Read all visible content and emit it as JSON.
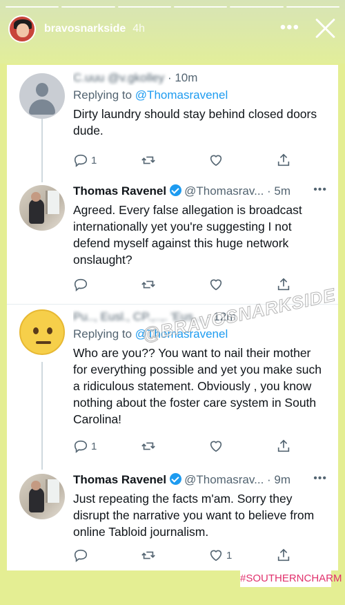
{
  "story": {
    "username": "bravosnarkside",
    "time": "4h",
    "more_icon": "more-horizontal-icon",
    "close_icon": "close-icon",
    "progress_segments": 6
  },
  "tweets": [
    {
      "author_name": "C.uuu @v.gkolley",
      "author_handle": "",
      "time": "· 10m",
      "blurred": true,
      "verified": false,
      "replying_label": "Replying to",
      "replying_to": "@Thomasravenel",
      "text": "Dirty laundry should stay behind closed doors dude.",
      "reply_count": "1",
      "like_count": ""
    },
    {
      "author_name": "Thomas Ravenel",
      "author_handle": "@Thomasrav...",
      "time": "· 5m",
      "blurred": false,
      "verified": true,
      "text": "Agreed.  Every false allegation is broadcast internationally yet you're suggesting I not defend myself against this huge network onslaught?",
      "reply_count": "",
      "like_count": ""
    },
    {
      "author_name": "Pu.., Eusl., CP.,..,.",
      "author_handle": "'Eus..,",
      "time": "· 12m",
      "blurred": true,
      "verified": false,
      "replying_label": "Replying to",
      "replying_to": "@Thomasravenel",
      "text": "Who are you?? You want to nail their mother for everything possible and yet you make such a ridiculous statement. Obviously , you know nothing about the foster care system in South Carolina!",
      "reply_count": "1",
      "like_count": ""
    },
    {
      "author_name": "Thomas Ravenel",
      "author_handle": "@Thomasrav...",
      "time": "· 9m",
      "blurred": false,
      "verified": true,
      "text": "Just repeating the facts m'am.  Sorry they disrupt the narrative you want to believe from online Tabloid journalism.",
      "reply_count": "",
      "like_count": "1"
    }
  ],
  "watermark": "@BRAVOSNARKSIDE",
  "hashtag": "#SOUTHERNCHARM",
  "colors": {
    "story_background": "#e4ee93",
    "twitter_blue": "#1d9bf0",
    "secondary_text": "#536471",
    "hashtag_pink": "#e1306c"
  }
}
